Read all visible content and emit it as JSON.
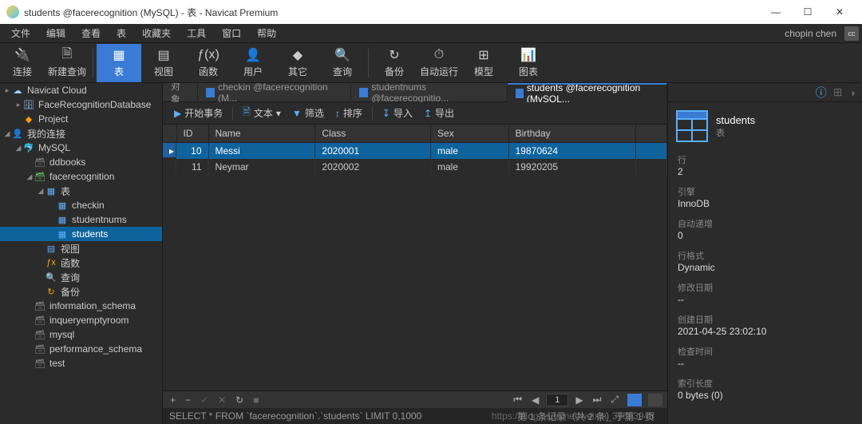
{
  "window": {
    "title": "students @facerecognition (MySQL) - 表 - Navicat Premium"
  },
  "menubar": {
    "items": [
      "文件",
      "编辑",
      "查看",
      "表",
      "收藏夹",
      "工具",
      "窗口",
      "帮助"
    ],
    "user": "chopin chen",
    "avatarInitials": "cc"
  },
  "toolbar": {
    "items": [
      {
        "label": "连接",
        "icon": "🔌"
      },
      {
        "label": "新建查询",
        "icon": "🗎"
      },
      {
        "label": "表",
        "icon": "▦",
        "active": true
      },
      {
        "label": "视图",
        "icon": "▤"
      },
      {
        "label": "函数",
        "icon": "ƒ(x)"
      },
      {
        "label": "用户",
        "icon": "👤"
      },
      {
        "label": "其它",
        "icon": "◆"
      },
      {
        "label": "查询",
        "icon": "🔍"
      },
      {
        "label": "备份",
        "icon": "↻"
      },
      {
        "label": "自动运行",
        "icon": "⏱"
      },
      {
        "label": "模型",
        "icon": "⊞"
      },
      {
        "label": "图表",
        "icon": "📊"
      }
    ]
  },
  "sidebar": {
    "nodes": [
      {
        "depth": 0,
        "toggle": "▸",
        "icon": "☁",
        "label": "Navicat Cloud",
        "color": "#9cf"
      },
      {
        "depth": 1,
        "toggle": "▸",
        "icon": "🗄",
        "label": "FaceRecognitionDatabase",
        "color": "#9cf"
      },
      {
        "depth": 1,
        "toggle": "",
        "icon": "◆",
        "label": "Project",
        "color": "#f90"
      },
      {
        "depth": 0,
        "toggle": "◢",
        "icon": "👤",
        "label": "我的连接",
        "color": "#9cf"
      },
      {
        "depth": 1,
        "toggle": "◢",
        "icon": "🐬",
        "label": "MySQL",
        "color": "#5bf"
      },
      {
        "depth": 2,
        "toggle": "",
        "icon": "🗃",
        "label": "ddbooks",
        "color": "#888"
      },
      {
        "depth": 2,
        "toggle": "◢",
        "icon": "🗃",
        "label": "facerecognition",
        "color": "#6c6"
      },
      {
        "depth": 3,
        "toggle": "◢",
        "icon": "▦",
        "label": "表",
        "color": "#5bb0ff"
      },
      {
        "depth": 4,
        "toggle": "",
        "icon": "▦",
        "label": "checkin",
        "color": "#5bb0ff"
      },
      {
        "depth": 4,
        "toggle": "",
        "icon": "▦",
        "label": "studentnums",
        "color": "#5bb0ff"
      },
      {
        "depth": 4,
        "toggle": "",
        "icon": "▦",
        "label": "students",
        "color": "#5bb0ff",
        "selected": true
      },
      {
        "depth": 3,
        "toggle": "",
        "icon": "▤",
        "label": "视图",
        "color": "#5bb0ff"
      },
      {
        "depth": 3,
        "toggle": "",
        "icon": "ƒx",
        "label": "函数",
        "color": "#fa0"
      },
      {
        "depth": 3,
        "toggle": "",
        "icon": "🔍",
        "label": "查询",
        "color": "#888"
      },
      {
        "depth": 3,
        "toggle": "",
        "icon": "↻",
        "label": "备份",
        "color": "#fa0"
      },
      {
        "depth": 2,
        "toggle": "",
        "icon": "🗃",
        "label": "information_schema",
        "color": "#888"
      },
      {
        "depth": 2,
        "toggle": "",
        "icon": "🗃",
        "label": "inqueryemptyroom",
        "color": "#888"
      },
      {
        "depth": 2,
        "toggle": "",
        "icon": "🗃",
        "label": "mysql",
        "color": "#888"
      },
      {
        "depth": 2,
        "toggle": "",
        "icon": "🗃",
        "label": "performance_schema",
        "color": "#888"
      },
      {
        "depth": 2,
        "toggle": "",
        "icon": "🗃",
        "label": "test",
        "color": "#888"
      }
    ]
  },
  "tabs": {
    "items": [
      {
        "label": "对象"
      },
      {
        "label": "checkin @facerecognition (M..."
      },
      {
        "label": "studentnums @facerecognitio..."
      },
      {
        "label": "students @facerecognition (MySQL...",
        "active": true
      }
    ]
  },
  "subtoolbar": {
    "beginTx": "开始事务",
    "text": "文本",
    "filter": "筛选",
    "sort": "排序",
    "import": "导入",
    "export": "导出"
  },
  "table": {
    "columns": [
      "ID",
      "Name",
      "Class",
      "Sex",
      "Birthday"
    ],
    "rows": [
      {
        "selected": true,
        "cells": [
          "10",
          "Messi",
          "2020001",
          "male",
          "19870624"
        ]
      },
      {
        "selected": false,
        "cells": [
          "11",
          "Neymar",
          "2020002",
          "male",
          "19920205"
        ]
      }
    ]
  },
  "gridfooter": {
    "page": "1"
  },
  "statusbar": {
    "sql": "SELECT * FROM `facerecognition`.`students` LIMIT 0,1000",
    "right": "第 1 条记录（共 2 条）于第 1 页",
    "watermark": "https://blog.csdn.net/weixin_39653948"
  },
  "rightpanel": {
    "title": "students",
    "subtitle": "表",
    "props": [
      {
        "label": "行",
        "value": "2"
      },
      {
        "label": "引擎",
        "value": "InnoDB"
      },
      {
        "label": "自动递增",
        "value": "0"
      },
      {
        "label": "行格式",
        "value": "Dynamic"
      },
      {
        "label": "修改日期",
        "value": "--"
      },
      {
        "label": "创建日期",
        "value": "2021-04-25 23:02:10"
      },
      {
        "label": "检查时间",
        "value": "--"
      },
      {
        "label": "索引长度",
        "value": "0 bytes (0)"
      }
    ]
  }
}
